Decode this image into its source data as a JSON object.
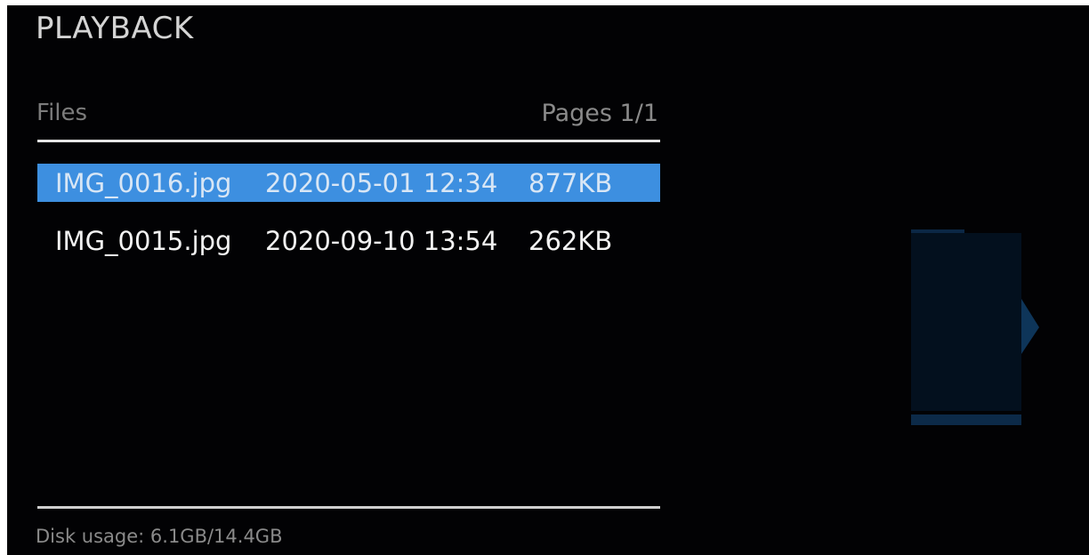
{
  "header": {
    "title": "PLAYBACK"
  },
  "list_header": {
    "files_label": "Files",
    "pages_label": "Pages 1/1"
  },
  "files": [
    {
      "name": "IMG_0016.jpg",
      "date": "2020-05-01 12:34",
      "size": "877KB",
      "selected": true
    },
    {
      "name": "IMG_0015.jpg",
      "date": "2020-09-10 13:54",
      "size": "262KB",
      "selected": false
    }
  ],
  "footer": {
    "disk_usage": "Disk usage: 6.1GB/14.4GB"
  },
  "colors": {
    "background": "#020204",
    "selection": "#3d8fe0",
    "preview_tint": "#0c2a48"
  }
}
